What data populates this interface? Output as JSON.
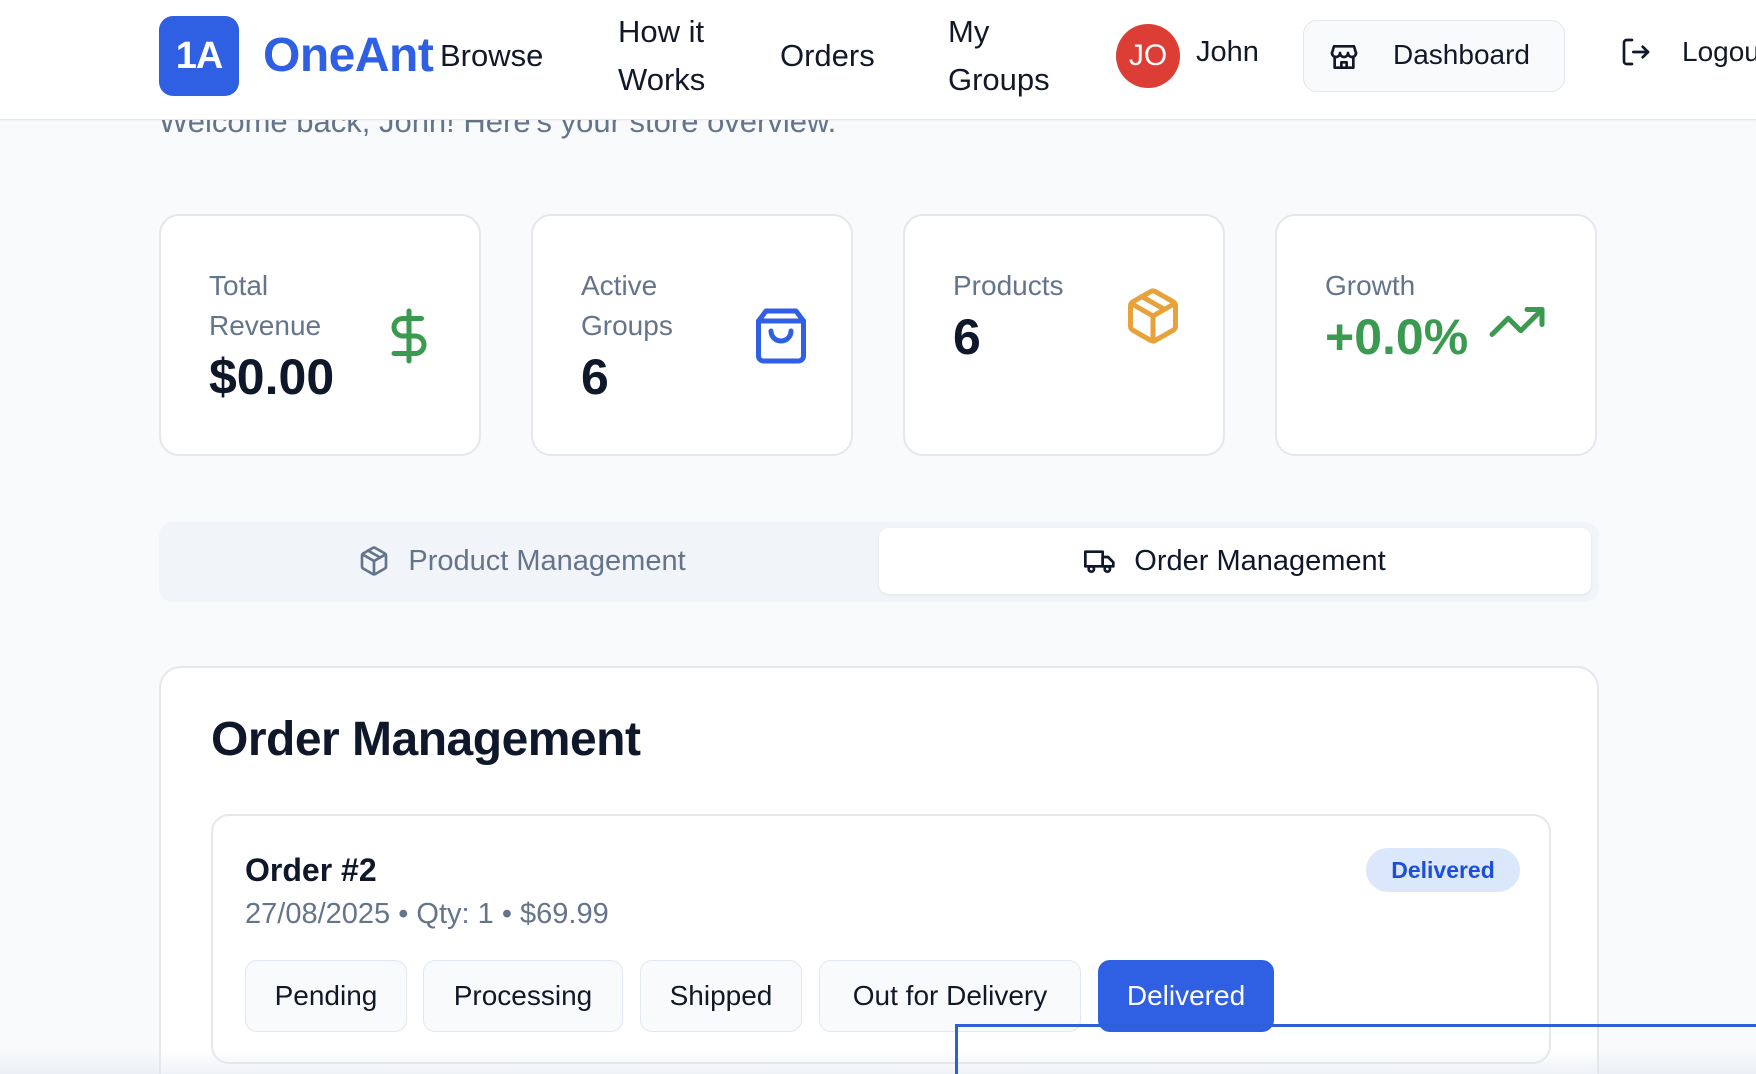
{
  "header": {
    "logo_badge": "1A",
    "logo_text": "OneAnt",
    "nav": [
      "Browse",
      "How it Works",
      "Orders",
      "My Groups"
    ],
    "user": {
      "initials": "JO",
      "name": "John"
    },
    "dashboard_label": "Dashboard",
    "logout_label": "Logout"
  },
  "welcome": "Welcome back, John! Here's your store overview.",
  "stats": {
    "revenue": {
      "label": "Total Revenue",
      "value": "$0.00",
      "icon": "dollar-icon",
      "color": "#3a9a4f"
    },
    "groups": {
      "label": "Active Groups",
      "value": "6",
      "icon": "shopping-bag-icon",
      "color": "#2f5fe3"
    },
    "products": {
      "label": "Products",
      "value": "6",
      "icon": "package-icon",
      "color": "#e8a23a"
    },
    "growth": {
      "label": "Growth",
      "value": "+0.0%",
      "icon": "trending-up-icon",
      "color": "#3a9a4f"
    }
  },
  "tabs": {
    "product": "Product Management",
    "order": "Order Management",
    "active": "order"
  },
  "orders_panel": {
    "title": "Order Management",
    "order": {
      "title": "Order #2",
      "meta": "27/08/2025 • Qty: 1 • $69.99",
      "status": "Delivered",
      "actions": [
        "Pending",
        "Processing",
        "Shipped",
        "Out for Delivery",
        "Delivered"
      ]
    }
  },
  "colors": {
    "brand": "#2f5fe3",
    "avatar": "#dc3e36",
    "success": "#3a9a4f",
    "warning": "#e8a23a"
  }
}
